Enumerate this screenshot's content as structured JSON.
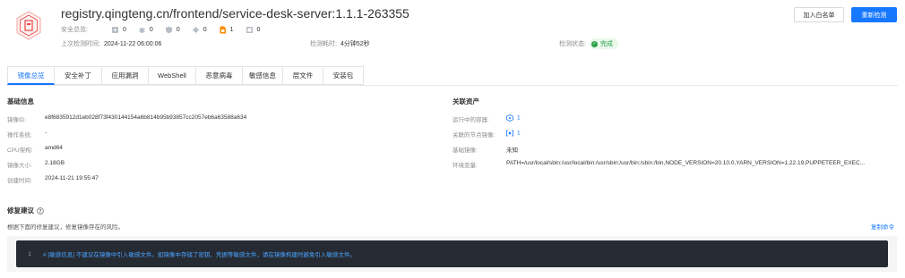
{
  "header": {
    "title": "registry.qingteng.cn/frontend/service-desk-server:1.1.1-263355",
    "security_overview_label": "安全总览:",
    "stats": [
      {
        "icon": "patch-icon",
        "count": "0",
        "color": "#b8bec6"
      },
      {
        "icon": "bug-icon",
        "count": "0",
        "color": "#b8bec6"
      },
      {
        "icon": "shield-icon",
        "count": "0",
        "color": "#b8bec6"
      },
      {
        "icon": "virus-icon",
        "count": "0",
        "color": "#b8bec6"
      },
      {
        "icon": "sensitive-file-icon",
        "count": "1",
        "color": "#ff8a00"
      },
      {
        "icon": "package-icon",
        "count": "0",
        "color": "#b8bec6"
      }
    ],
    "last_check_label": "上次检测时间:",
    "last_check_value": "2024-11-22 06:00:06",
    "duration_label": "检测耗时:",
    "duration_value": "4分钟52秒",
    "status_label": "检测状态:",
    "status_value": "完成",
    "btn_whitelist": "加入白名单",
    "btn_recheck": "重新检测"
  },
  "tabs": [
    "镜像总览",
    "安全补丁",
    "应用漏洞",
    "WebShell",
    "恶意病毒",
    "敏感信息",
    "层文件",
    "安装包"
  ],
  "basic_info": {
    "title": "基础信息",
    "rows": [
      {
        "label": "镜像ID:",
        "value": "e8f6835912d1eb028f73f430144154a6b814b95b93857cc2057eb6a63588a634"
      },
      {
        "label": "操作系统:",
        "value": "-"
      },
      {
        "label": "CPU架构:",
        "value": "amd64"
      },
      {
        "label": "镜像大小:",
        "value": "2.18GB"
      },
      {
        "label": "创建时间:",
        "value": "2024-11-21 19:55:47"
      }
    ]
  },
  "related_assets": {
    "title": "关联资产",
    "running_label": "运行中的容器:",
    "running_value": "1",
    "node_label": "关联的节点镜像:",
    "node_value": "1",
    "base_label": "基础镜像:",
    "base_value": "未知",
    "env_label": "环境变量:",
    "env_value": "PATH=/usr/local/sbin:/usr/local/bin:/usr/sbin:/usr/bin:/sbin:/bin,NODE_VERSION=20.10.0,YARN_VERSION=1.22.19,PUPPETEER_EXEC..."
  },
  "advice": {
    "title": "修复建议",
    "desc": "根据下面的修复建议，修复镜像存在的风险。",
    "copy": "复制命令",
    "line_no": "1",
    "code": "# [敏感信息] 不建议在镜像中引入敏感文件。如镜像中存储了密钥、凭据等敏感文件，请在镜像构建时避免引入敏感文件。"
  },
  "colors": {
    "accent": "#1677ff",
    "success": "#2aa14a",
    "warning": "#ff8a00"
  }
}
